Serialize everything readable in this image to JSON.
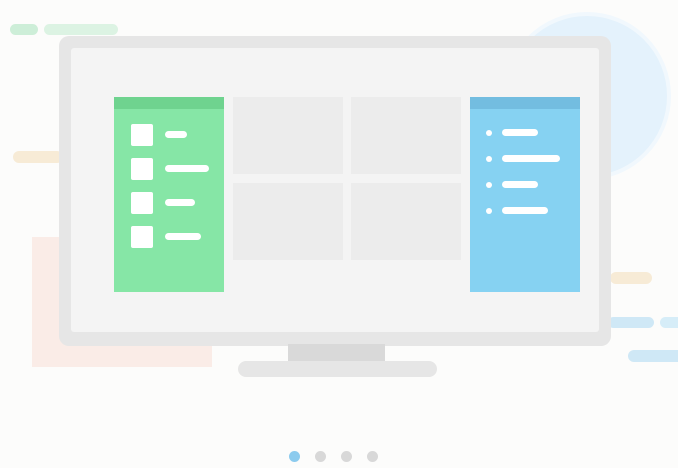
{
  "colors": {
    "background": "#fcfcfb",
    "left_panel": "#86e6a6",
    "right_panel": "#86d2f2",
    "pager_active": "#8ccbee",
    "pager_inactive": "#d8d8d8"
  },
  "illustration": {
    "left_panel_rows": 4,
    "right_panel_rows": 4,
    "grid_tiles": 4
  },
  "pagination": {
    "pages": 4,
    "active_index": 0
  }
}
